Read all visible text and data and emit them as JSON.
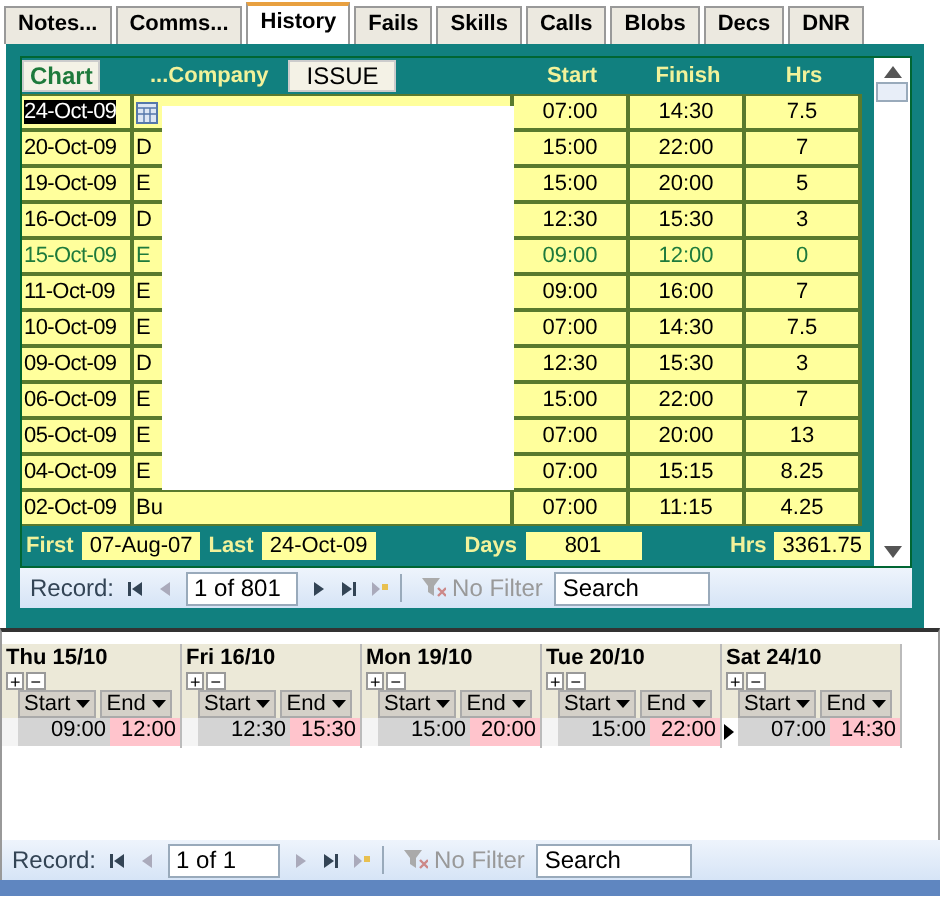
{
  "tabs": [
    {
      "label": "Notes...",
      "selected": false
    },
    {
      "label": "Comms...",
      "selected": false
    },
    {
      "label": "History",
      "selected": true
    },
    {
      "label": "Fails",
      "selected": false
    },
    {
      "label": "Skills",
      "selected": false
    },
    {
      "label": "Calls",
      "selected": false
    },
    {
      "label": "Blobs",
      "selected": false
    },
    {
      "label": "Decs",
      "selected": false
    },
    {
      "label": "DNR",
      "selected": false
    }
  ],
  "history": {
    "chart_button": "Chart",
    "company_header": "...Company",
    "issue_button": "ISSUE",
    "columns": [
      "Start",
      "Finish",
      "Hrs"
    ],
    "rows": [
      {
        "date": "24-Oct-09",
        "focused": true,
        "color": "#000000",
        "start": "07:00",
        "finish": "14:30",
        "hrs": "7.5"
      },
      {
        "date": "20-Oct-09",
        "focused": false,
        "company": "D",
        "color": "#000000",
        "start": "15:00",
        "finish": "22:00",
        "hrs": "7"
      },
      {
        "date": "19-Oct-09",
        "focused": false,
        "company": "E",
        "color": "#000000",
        "start": "15:00",
        "finish": "20:00",
        "hrs": "5"
      },
      {
        "date": "16-Oct-09",
        "focused": false,
        "company": "D",
        "color": "#000000",
        "start": "12:30",
        "finish": "15:30",
        "hrs": "3"
      },
      {
        "date": "15-Oct-09",
        "focused": false,
        "company": "E",
        "color": "#1e7a3c",
        "start": "09:00",
        "finish": "12:00",
        "hrs": "0"
      },
      {
        "date": "11-Oct-09",
        "focused": false,
        "company": "E",
        "color": "#000000",
        "start": "09:00",
        "finish": "16:00",
        "hrs": "7"
      },
      {
        "date": "10-Oct-09",
        "focused": false,
        "company": "E",
        "color": "#000000",
        "start": "07:00",
        "finish": "14:30",
        "hrs": "7.5"
      },
      {
        "date": "09-Oct-09",
        "focused": false,
        "company": "D",
        "color": "#000000",
        "start": "12:30",
        "finish": "15:30",
        "hrs": "3"
      },
      {
        "date": "06-Oct-09",
        "focused": false,
        "company": "E",
        "color": "#000000",
        "start": "15:00",
        "finish": "22:00",
        "hrs": "7"
      },
      {
        "date": "05-Oct-09",
        "focused": false,
        "company": "E",
        "color": "#000000",
        "start": "07:00",
        "finish": "20:00",
        "hrs": "13"
      },
      {
        "date": "04-Oct-09",
        "focused": false,
        "company": "E",
        "color": "#000000",
        "start": "07:00",
        "finish": "15:15",
        "hrs": "8.25"
      },
      {
        "date": "02-Oct-09",
        "focused": false,
        "company": "Bu",
        "color": "#000000",
        "start": "07:00",
        "finish": "11:15",
        "hrs": "4.25"
      }
    ],
    "totals": [
      {
        "label": "First",
        "value": "07-Aug-07"
      },
      {
        "label": "Last",
        "value": "24-Oct-09"
      },
      {
        "label": "Days",
        "value": "801"
      },
      {
        "label": "Hrs",
        "value": "3361.75"
      }
    ],
    "navigator": {
      "label": "Record:",
      "position": "1 of 801",
      "next_enabled": true,
      "filter": "No Filter",
      "search": {
        "placeholder": "Search"
      }
    }
  },
  "days": [
    {
      "title": "Thu 15/10",
      "expand": "+",
      "collapse": "−",
      "columns": [
        "Start",
        "End"
      ],
      "start": "09:00",
      "end": "12:00",
      "current": false
    },
    {
      "title": "Fri 16/10",
      "expand": "+",
      "collapse": "−",
      "columns": [
        "Start",
        "End"
      ],
      "start": "12:30",
      "end": "15:30",
      "current": false
    },
    {
      "title": "Mon 19/10",
      "expand": "+",
      "collapse": "−",
      "columns": [
        "Start",
        "End"
      ],
      "start": "15:00",
      "end": "20:00",
      "current": false
    },
    {
      "title": "Tue 20/10",
      "expand": "+",
      "collapse": "−",
      "columns": [
        "Start",
        "End"
      ],
      "start": "15:00",
      "end": "22:00",
      "current": false
    },
    {
      "title": "Sat 24/10",
      "expand": "+",
      "collapse": "−",
      "columns": [
        "Start",
        "End"
      ],
      "start": "07:00",
      "end": "14:30",
      "current": true
    }
  ],
  "day_navigator": {
    "label": "Record:",
    "position": "1 of 1",
    "next_enabled": false,
    "filter": "No Filter",
    "search": {
      "placeholder": "Search"
    }
  }
}
